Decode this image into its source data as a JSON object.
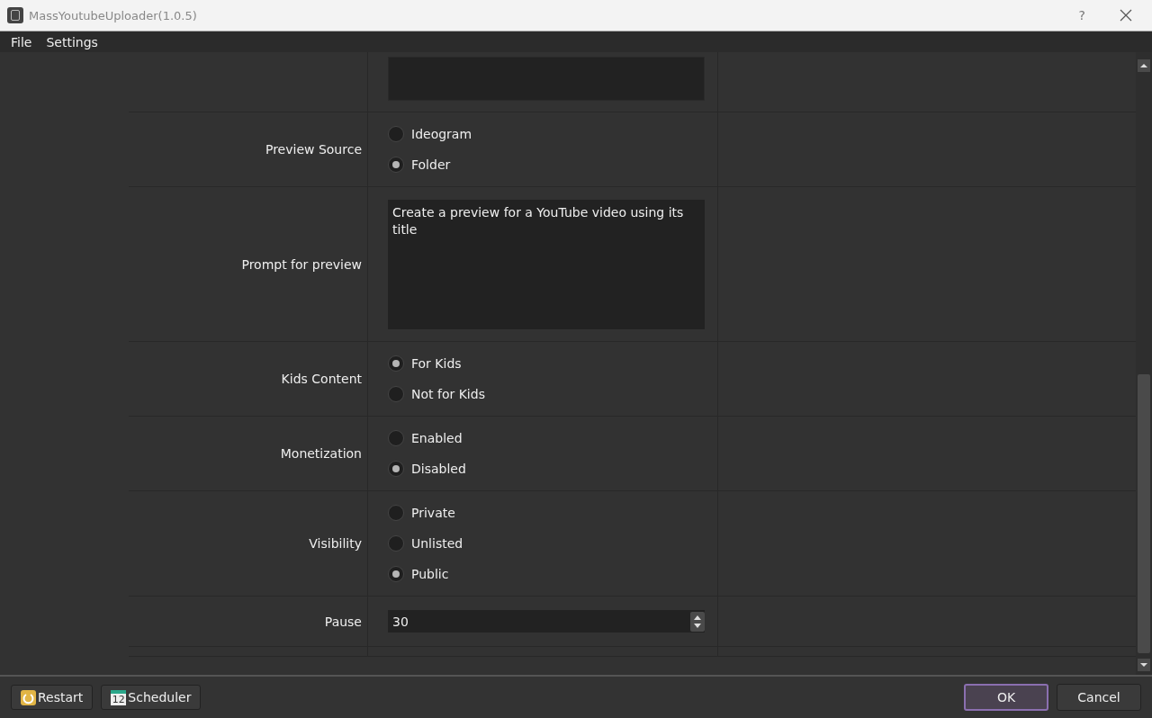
{
  "window": {
    "title": "MassYoutubeUploader(1.0.5)",
    "help": "?"
  },
  "menu": [
    "File",
    "Settings"
  ],
  "rows": [
    {
      "kind": "box"
    },
    {
      "kind": "radio",
      "label": "Preview Source",
      "options": [
        {
          "label": "Ideogram",
          "selected": false
        },
        {
          "label": "Folder",
          "selected": true
        }
      ]
    },
    {
      "kind": "textarea",
      "label": "Prompt for preview",
      "value": "Create a preview for a YouTube video using its title"
    },
    {
      "kind": "radio",
      "label": "Kids Content",
      "options": [
        {
          "label": "For Kids",
          "selected": true
        },
        {
          "label": "Not for Kids",
          "selected": false
        }
      ]
    },
    {
      "kind": "radio",
      "label": "Monetization",
      "options": [
        {
          "label": "Enabled",
          "selected": false
        },
        {
          "label": "Disabled",
          "selected": true
        }
      ]
    },
    {
      "kind": "radio",
      "label": "Visibility",
      "options": [
        {
          "label": "Private",
          "selected": false
        },
        {
          "label": "Unlisted",
          "selected": false
        },
        {
          "label": "Public",
          "selected": true
        }
      ]
    },
    {
      "kind": "spin",
      "label": "Pause",
      "value": "30"
    }
  ],
  "footer": {
    "left": [
      {
        "label": "Restart",
        "kind": "restart"
      },
      {
        "label": "Scheduler",
        "kind": "calendar",
        "icon_text": "12"
      }
    ],
    "right": [
      {
        "label": "OK",
        "selected": true
      },
      {
        "label": "Cancel",
        "selected": false
      }
    ]
  }
}
